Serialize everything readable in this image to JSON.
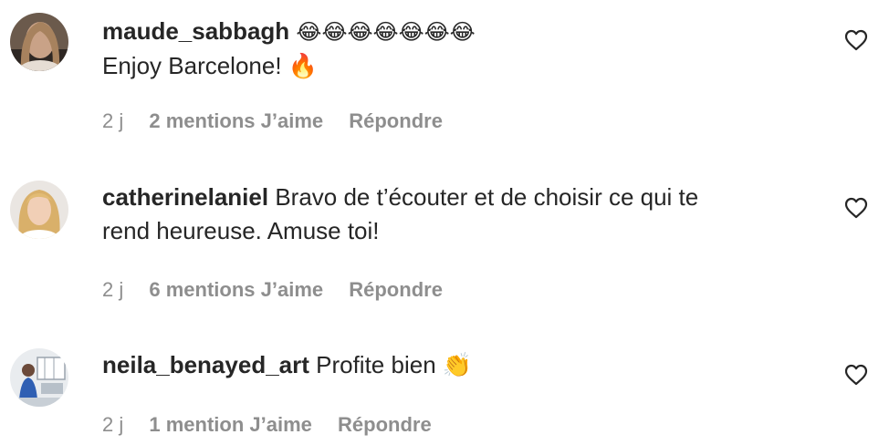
{
  "comments": [
    {
      "username": "maude_sabbagh",
      "header_emojis": "😂😂😂😂😂😂😂",
      "text": "Enjoy Barcelone! 🔥",
      "age": "2 j",
      "likes": "2 mentions J’aime",
      "reply": "Répondre"
    },
    {
      "username": "catherinelaniel",
      "text_line1": "Bravo de t’écouter et de choisir ce qui te",
      "text_line2": "rend heureuse. Amuse toi!",
      "age": "2 j",
      "likes": "6 mentions J’aime",
      "reply": "Répondre"
    },
    {
      "username": "neila_benayed_art",
      "text": "Profite bien 👏",
      "age": "2 j",
      "likes": "1 mention J’aime",
      "reply": "Répondre"
    }
  ],
  "icons": {
    "like": "heart-outline-icon"
  },
  "colors": {
    "text": "#262626",
    "secondary": "#8e8e8e",
    "background": "#ffffff"
  }
}
